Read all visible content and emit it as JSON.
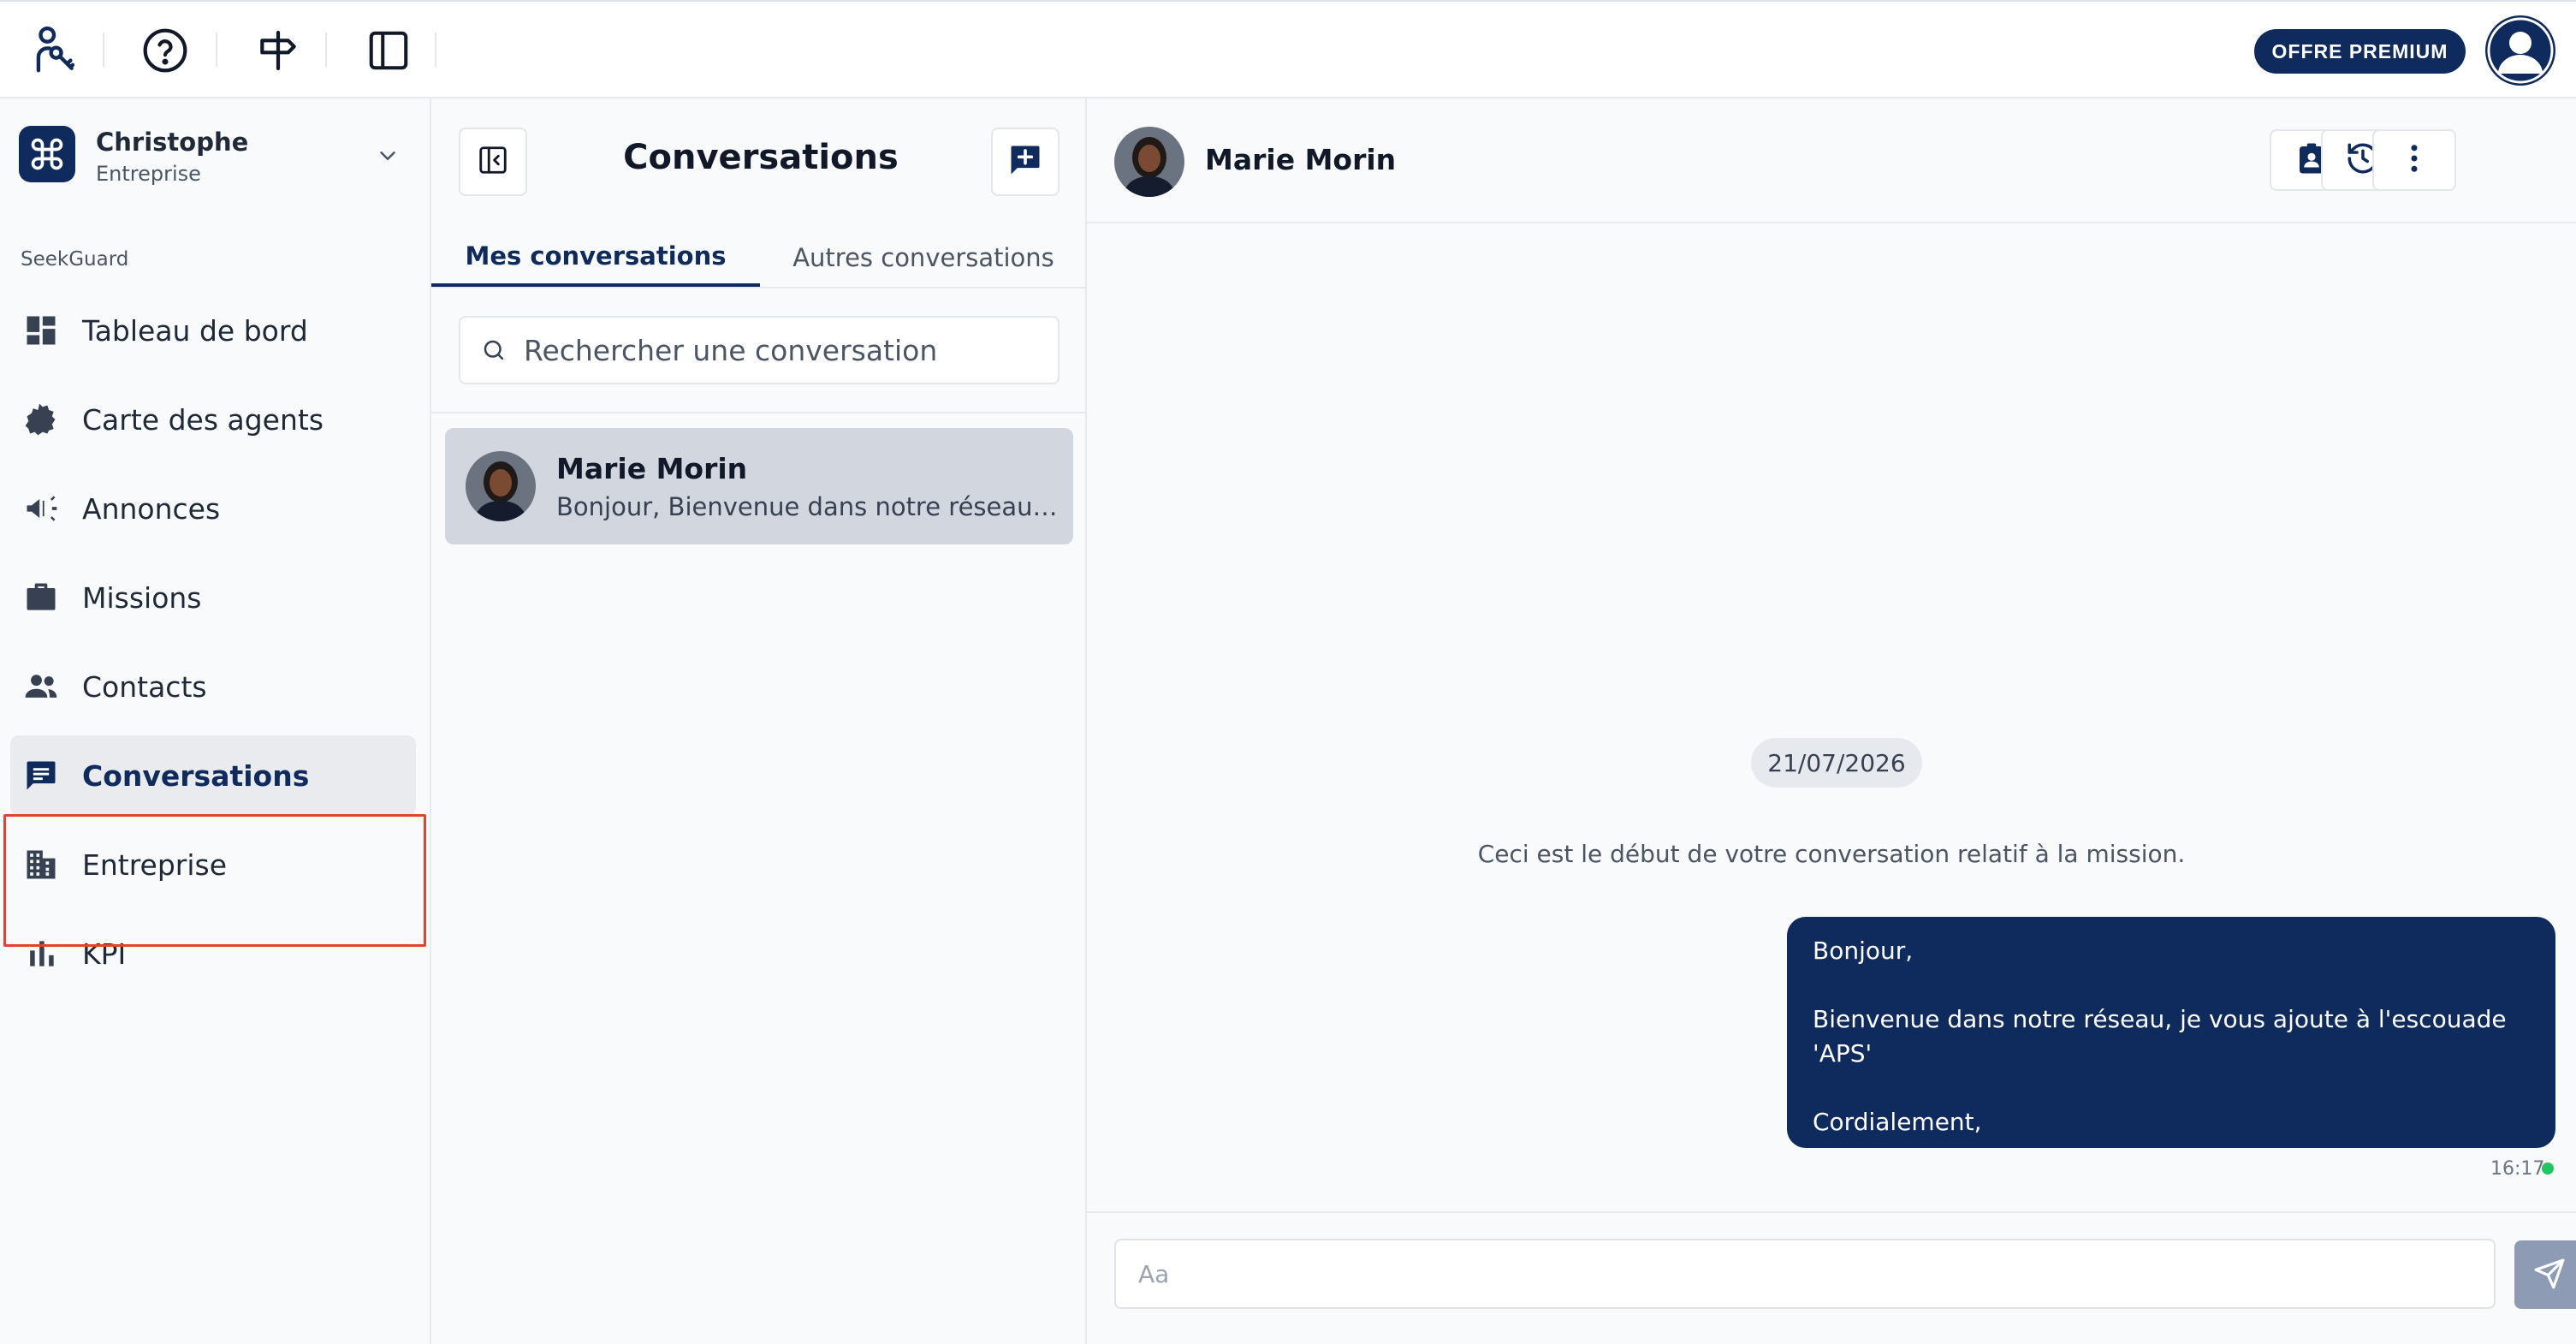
{
  "colors": {
    "brand": "#0f2a5c",
    "active_item_bg": "#e9ebee",
    "selected_conversation_bg": "#d1d6df",
    "highlight": "#e2432e",
    "online_dot": "#22c55e",
    "send_button": "#8e9bb4"
  },
  "topbar": {
    "icons": [
      "person-key-icon",
      "help-circle-icon",
      "signpost-icon",
      "sidebar-panel-icon"
    ],
    "premium_label": "OFFRE PREMIUM",
    "avatar_icon": "user-avatar-icon"
  },
  "sidebar": {
    "org": {
      "name": "Christophe",
      "subtitle": "Entreprise",
      "logo_icon": "command-icon",
      "expand_icon": "chevron-down-icon"
    },
    "section_label": "SeekGuard",
    "items": [
      {
        "label": "Tableau de bord",
        "icon": "dashboard-icon",
        "active": false
      },
      {
        "label": "Carte des agents",
        "icon": "france-map-icon",
        "active": false
      },
      {
        "label": "Annonces",
        "icon": "megaphone-icon",
        "active": false
      },
      {
        "label": "Missions",
        "icon": "briefcase-icon",
        "active": false
      },
      {
        "label": "Contacts",
        "icon": "people-icon",
        "active": false
      },
      {
        "label": "Conversations",
        "icon": "chat-icon",
        "active": true
      },
      {
        "label": "Entreprise",
        "icon": "building-icon",
        "active": false
      },
      {
        "label": "KPI",
        "icon": "bar-chart-icon",
        "active": false
      }
    ]
  },
  "conversations": {
    "title": "Conversations",
    "tabs": [
      {
        "label": "Mes conversations",
        "active": true
      },
      {
        "label": "Autres conversations",
        "active": false
      }
    ],
    "search_placeholder": "Rechercher une conversation",
    "items": [
      {
        "name": "Marie Morin",
        "preview": "Bonjour, Bienvenue dans notre réseau, je vous ajoute à l'escouade 'APS' Cordialement,",
        "selected": true
      }
    ]
  },
  "chat": {
    "contact_name": "Marie Morin",
    "header_actions": [
      "contact-card-icon",
      "history-icon",
      "more-vertical-icon"
    ],
    "date": "21/07/2026",
    "system_message": "Ceci est le début de votre conversation relatif à la mission.",
    "messages": [
      {
        "lines": [
          "Bonjour,",
          "",
          "Bienvenue dans notre réseau, je vous ajoute à l'escouade 'APS'",
          "",
          "Cordialement,"
        ],
        "time": "16:17"
      }
    ],
    "composer_placeholder": "Aa"
  }
}
